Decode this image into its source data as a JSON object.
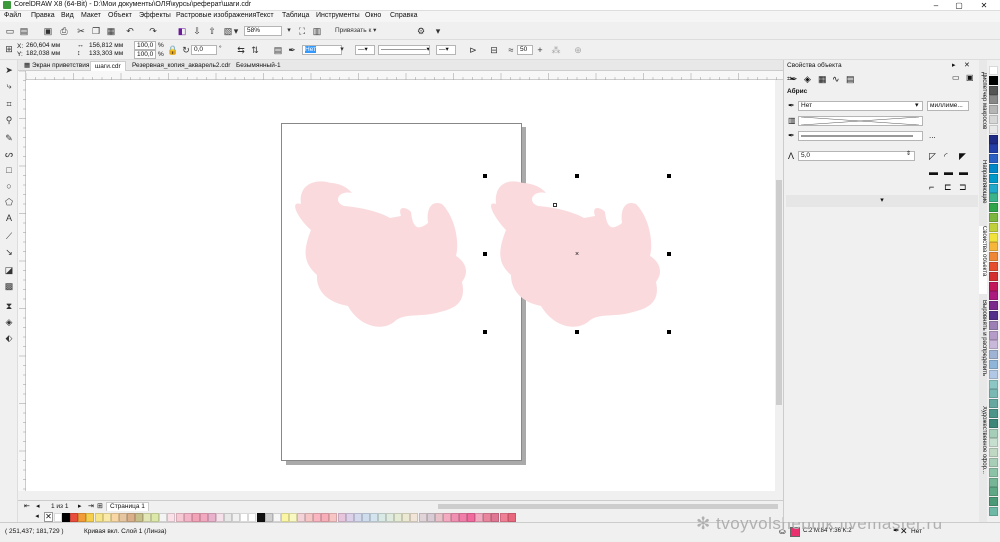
{
  "window": {
    "title": "CorelDRAW X8 (64-Bit) - D:\\Мои документы\\ОЛЯ\\курсы\\реферат\\шаги.cdr"
  },
  "menu": [
    "Файл",
    "Правка",
    "Вид",
    "Макет",
    "Объект",
    "Эффекты",
    "Растровые изображения",
    "Текст",
    "Таблица",
    "Инструменты",
    "Окно",
    "Справка"
  ],
  "toolbar": {
    "zoom": "58%",
    "snap_label": "Привязать к",
    "snap_arrow": "▾"
  },
  "propbar": {
    "x_label": "X:",
    "x_value": "260,604 мм",
    "y_label": "Y:",
    "y_value": "182,038 мм",
    "w_value": "156,812 мм",
    "h_value": "133,303 мм",
    "scale_w": "100,0",
    "scale_h": "100,0",
    "percent": "%",
    "angle": "0,0",
    "angle_unit": "°",
    "outline_fill": "Нет",
    "smooth_value": "50"
  },
  "doc_tabs": [
    "Экран приветствия",
    "шаги.cdr",
    "Резервная_копия_акварель2.cdr",
    "Безымянный-1"
  ],
  "active_tab": 1,
  "pagebar": {
    "page_count": "1 из 1",
    "page_name": "Страница 1"
  },
  "status": {
    "coords": "( 251,437; 181,729 )",
    "object_info": "Кривая вкл. Слой 1  (Линза)",
    "color_info": "C:2 M:84 Y:36 K:2",
    "outline_info": "Нет"
  },
  "watermark": "tvoyvolshebnik.livemaster.ru",
  "panel": {
    "title": "Свойства объекта",
    "section": "Абрис",
    "width_value": "Нет",
    "unit": "миллиме...",
    "miter_value": "5,0",
    "more": "..."
  },
  "side_tabs": [
    "Диспетчер макросов",
    "Направляющие",
    "Свойства объекта",
    "Выровнять и распределить",
    "Художественное офор..."
  ],
  "colors": {
    "shape_fill": "#fadadd",
    "page_shadow": "#aaaaaa",
    "accent": "#3399ff"
  },
  "palette_bottom": [
    "#ffffff",
    "#000000",
    "#e94d3c",
    "#f29c38",
    "#f6d04d",
    "#f7e58c",
    "#fbe9a8",
    "#f8d7a4",
    "#e6c6a0",
    "#d9b089",
    "#c8c08a",
    "#e3e7b5",
    "#dbe8a8",
    "#f4f4f4",
    "#fbe0e8",
    "#f7c9d5",
    "#f5b5c8",
    "#f3a3b7",
    "#f2a9c0",
    "#eab1cc",
    "#f6e0ea",
    "#e8e8e8",
    "#f1f1f1",
    "#ffffff",
    "#ffffff",
    "#111111",
    "#d0d0d0",
    "#f6f6f6",
    "#faf6a4",
    "#f8f8c0",
    "#f3d2d8",
    "#f6c6c6",
    "#f9b6c0",
    "#f7aeb8",
    "#f8c5c5",
    "#e7c5dc",
    "#ddd1ea",
    "#d5d9ee",
    "#cfdcee",
    "#d3e4ef",
    "#d8e9e6",
    "#e0ebe0",
    "#e5ecd5",
    "#ebe9d1",
    "#f0e5d6",
    "#e0d4d8",
    "#d8cbd3",
    "#e9c1c9",
    "#f4aac0",
    "#f18fb2",
    "#f17ea8",
    "#f06a9e",
    "#f3a9bf",
    "#e9859d",
    "#df7693",
    "#f07f95",
    "#e9677d"
  ],
  "palette_right": [
    "#ffffff",
    "#000000",
    "#555555",
    "#888888",
    "#b5b5b5",
    "#d6d6d6",
    "#e8e8e8",
    "#1f2a84",
    "#233fa7",
    "#2b5fc4",
    "#0087c7",
    "#0098c8",
    "#22a9c9",
    "#3ab38b",
    "#2fa44b",
    "#7cb63f",
    "#c0cf3c",
    "#f2e23c",
    "#f5b63a",
    "#ef8836",
    "#e54d2e",
    "#d32f2f",
    "#c2185b",
    "#ad1a7f",
    "#7b2a8c",
    "#532d8a",
    "#9c7fb5",
    "#b59cc8",
    "#c8b8d9",
    "#9fb3d5",
    "#8fb6d9",
    "#b0c8e6",
    "#8cc7c6",
    "#79b8b3",
    "#66a89f",
    "#4e9589",
    "#3c8777",
    "#a5cdb8",
    "#c6dfcf",
    "#bfd8c4",
    "#a8ceb8",
    "#8cc2a6",
    "#76b697",
    "#5ea885",
    "#4b9a77",
    "#6eb9a6"
  ]
}
